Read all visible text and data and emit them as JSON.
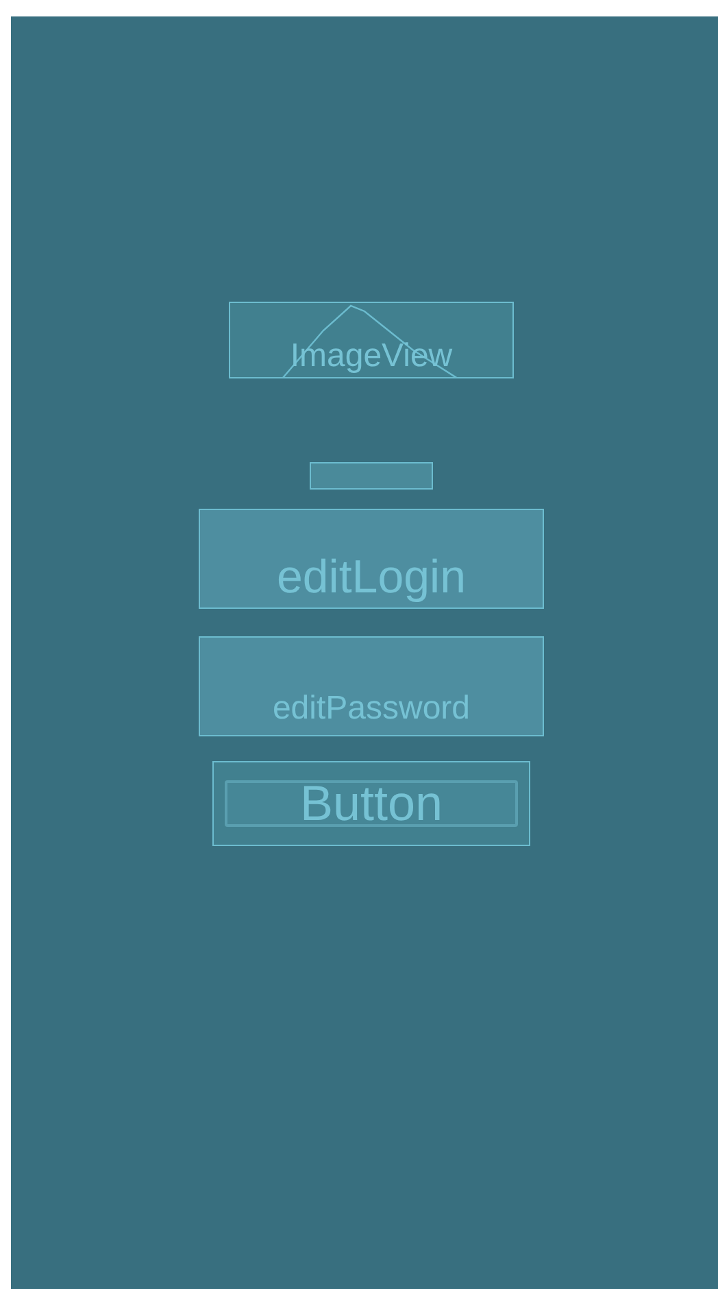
{
  "widgets": [
    {
      "kind": "image",
      "label": "ImageView"
    },
    {
      "kind": "text"
    },
    {
      "kind": "edit",
      "value": "editLogin"
    },
    {
      "kind": "edit",
      "placeholder": "editPassword"
    },
    {
      "kind": "button",
      "label": "Button"
    }
  ]
}
